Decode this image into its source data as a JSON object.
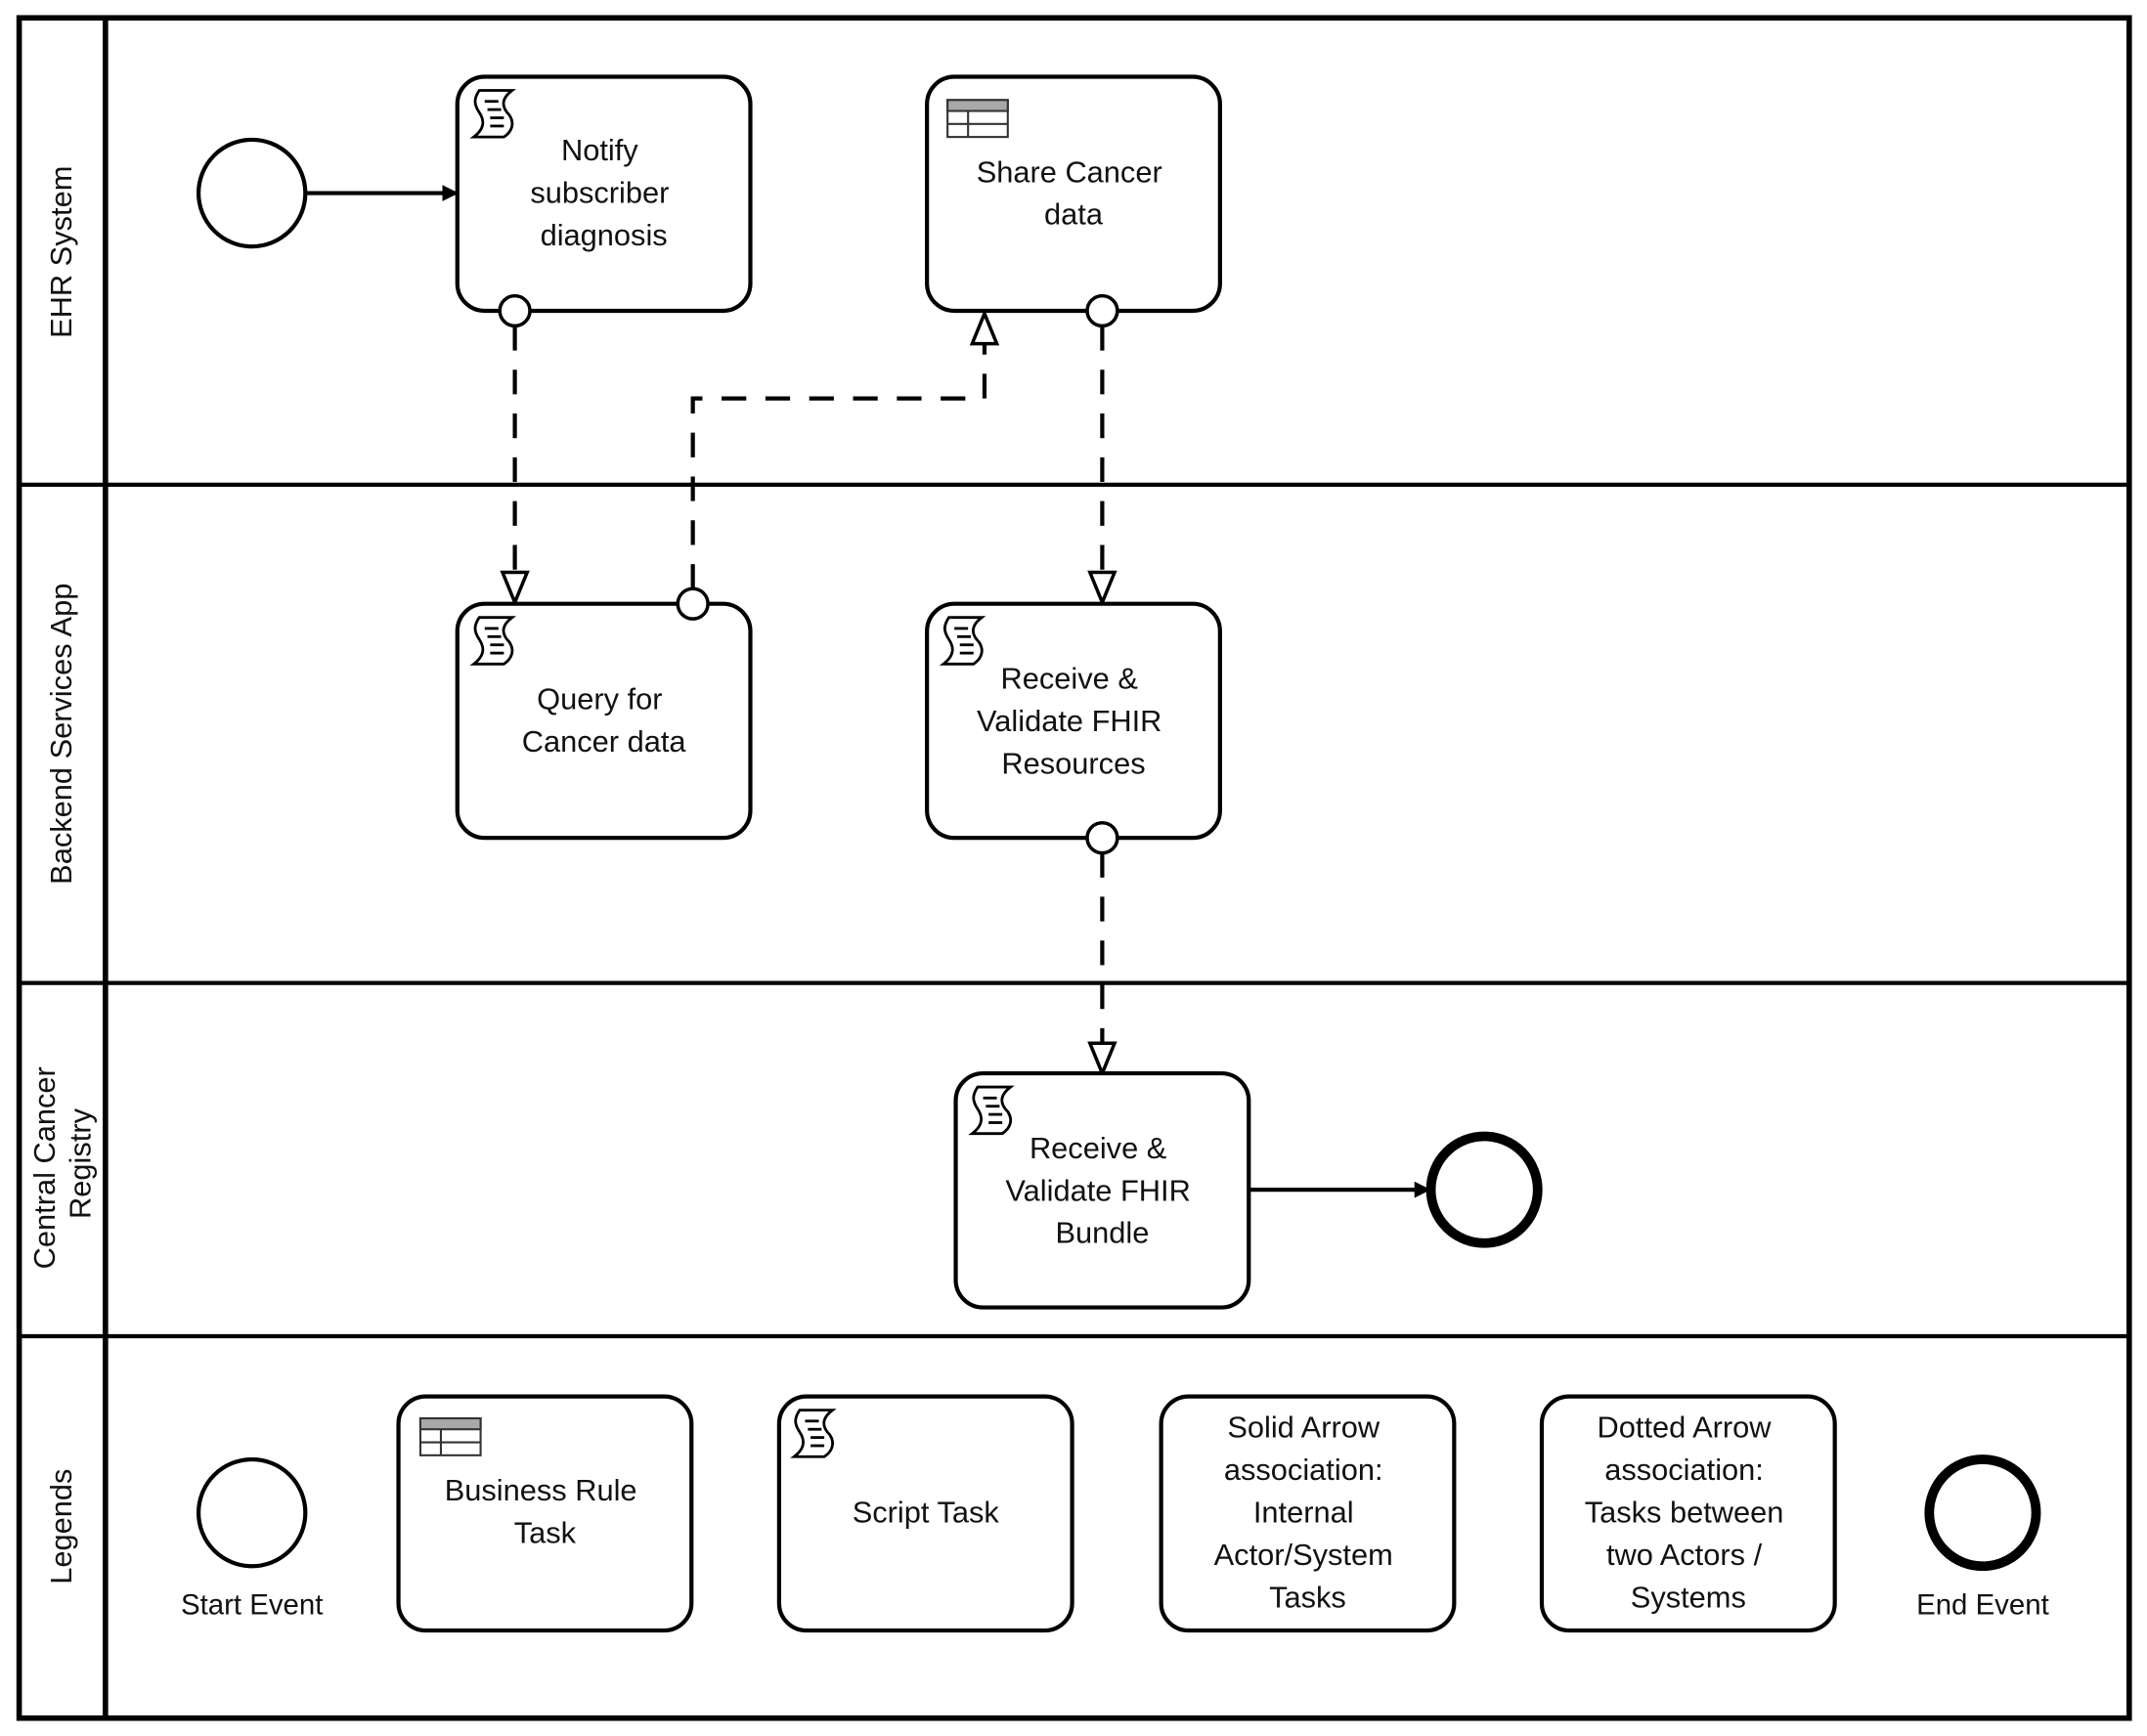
{
  "lanes": [
    {
      "label_lines": [
        "EHR System"
      ]
    },
    {
      "label_lines": [
        "Backend Services App"
      ]
    },
    {
      "label_lines": [
        "Central Cancer",
        "Registry"
      ]
    },
    {
      "label_lines": [
        "Legends"
      ]
    }
  ],
  "tasks": {
    "notify": {
      "type": "script",
      "lines": [
        "Notify",
        "subscriber",
        "diagnosis"
      ]
    },
    "share": {
      "type": "business-rule",
      "lines": [
        "Share Cancer",
        "data"
      ]
    },
    "query": {
      "type": "script",
      "lines": [
        "Query for",
        "Cancer data"
      ]
    },
    "receive_resources": {
      "type": "script",
      "lines": [
        "Receive &",
        "Validate FHIR",
        "Resources"
      ]
    },
    "receive_bundle": {
      "type": "script",
      "lines": [
        "Receive &",
        "Validate FHIR",
        "Bundle"
      ]
    }
  },
  "legend": {
    "start_event": "Start Event",
    "business_rule": [
      "Business Rule",
      "Task"
    ],
    "script_task": [
      "Script Task"
    ],
    "solid_arrow": [
      "Solid Arrow",
      "association:",
      "Internal",
      "Actor/System",
      "Tasks"
    ],
    "dotted_arrow": [
      "Dotted Arrow",
      "association:",
      "Tasks between",
      "two Actors /",
      "Systems"
    ],
    "end_event": "End Event"
  },
  "colors": {
    "stroke": "#000000",
    "table_header": "#a8a8a8",
    "background": "#ffffff"
  }
}
